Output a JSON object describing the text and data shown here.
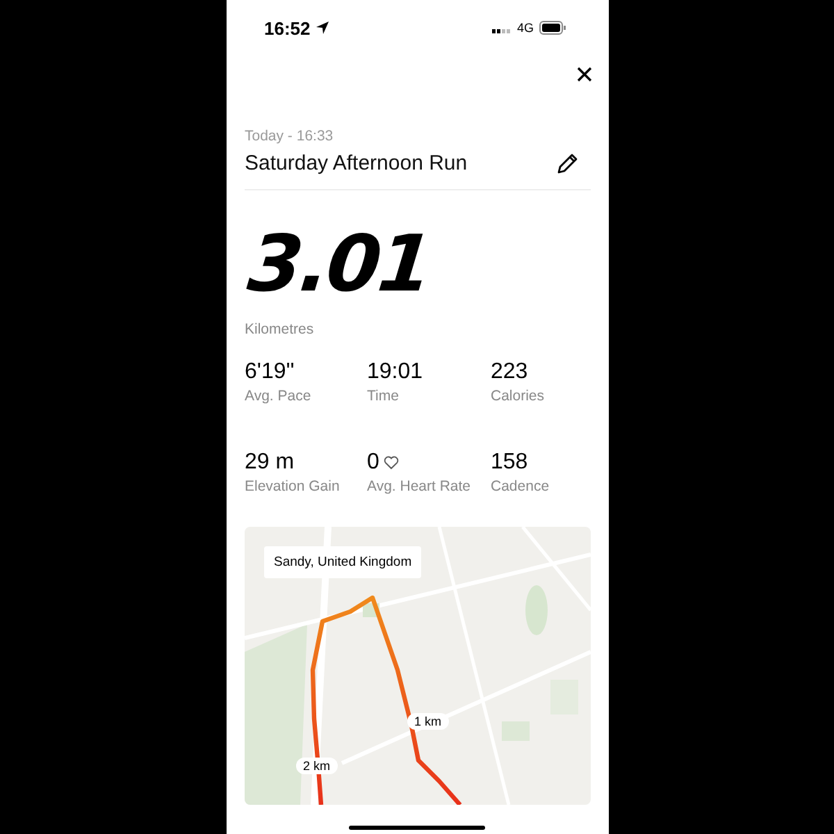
{
  "status_bar": {
    "time": "16:52",
    "network": "4G"
  },
  "activity": {
    "date": "Today - 16:33",
    "title": "Saturday Afternoon Run"
  },
  "distance": {
    "value": "3.01",
    "unit": "Kilometres"
  },
  "stats": [
    {
      "kind": "plain",
      "value": "6'19''",
      "label": "Avg. Pace"
    },
    {
      "kind": "plain",
      "value": "19:01",
      "label": "Time"
    },
    {
      "kind": "plain",
      "value": "223",
      "label": "Calories"
    },
    {
      "kind": "plain",
      "value": "29 m",
      "label": "Elevation Gain"
    },
    {
      "kind": "heart",
      "value": "0",
      "label": "Avg. Heart Rate"
    },
    {
      "kind": "plain",
      "value": "158",
      "label": "Cadence"
    }
  ],
  "map": {
    "location": "Sandy, United Kingdom",
    "markers": [
      {
        "label": "1 km"
      },
      {
        "label": "2 km"
      }
    ]
  }
}
